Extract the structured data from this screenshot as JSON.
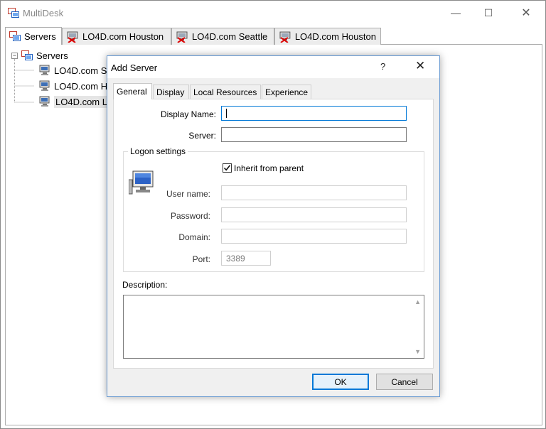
{
  "app": {
    "title": "MultiDesk"
  },
  "window_controls": {
    "minimize": "—",
    "maximize": "☐",
    "close": "✕"
  },
  "main_tabs": [
    {
      "label": "Servers",
      "icon": "servers-icon"
    },
    {
      "label": "LO4D.com Houston",
      "icon": "disconnected-server-icon"
    },
    {
      "label": "LO4D.com Seattle",
      "icon": "disconnected-server-icon"
    },
    {
      "label": "LO4D.com Houston",
      "icon": "disconnected-server-icon"
    }
  ],
  "tree": {
    "root_label": "Servers",
    "expander": "−",
    "items": [
      {
        "label": "LO4D.com Se"
      },
      {
        "label": "LO4D.com H"
      },
      {
        "label": "LO4D.com Lo"
      }
    ]
  },
  "dialog": {
    "title": "Add Server",
    "help": "?",
    "close": "✕",
    "tabs": [
      "General",
      "Display",
      "Local Resources",
      "Experience"
    ],
    "fields": {
      "display_name_label": "Display Name:",
      "display_name_value": "",
      "server_label": "Server:",
      "server_value": ""
    },
    "logon": {
      "group_title": "Logon settings",
      "inherit_label": "Inherit from parent",
      "inherit_checked": true,
      "username_label": "User name:",
      "password_label": "Password:",
      "domain_label": "Domain:",
      "port_label": "Port:",
      "port_value": "3389"
    },
    "description_label": "Description:",
    "ok_label": "OK",
    "cancel_label": "Cancel"
  },
  "colors": {
    "accent": "#0078d7",
    "dialog_border": "#6b9bd2",
    "dialog_bg": "#f0f0f0"
  }
}
